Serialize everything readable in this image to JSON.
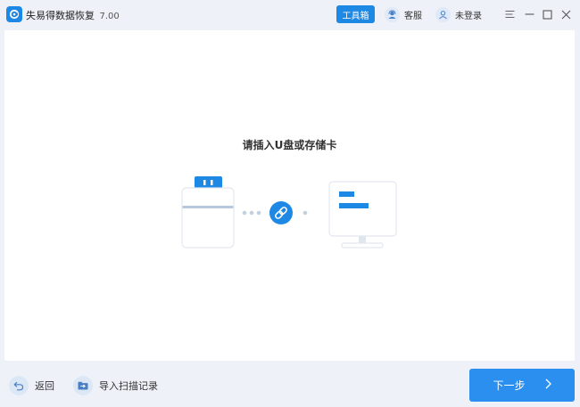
{
  "app": {
    "name": "失易得数据恢复",
    "version": "7.00"
  },
  "titlebar": {
    "toolbox_label": "工具箱",
    "service_label": "客服",
    "login_label": "未登录"
  },
  "main": {
    "prompt": "请插入U盘或存储卡"
  },
  "footer": {
    "back_label": "返回",
    "import_label": "导入扫描记录",
    "next_label": "下一步"
  },
  "colors": {
    "accent": "#1e88e5",
    "next_button": "#2b8ff0",
    "background": "#eef2f8"
  },
  "icons": {
    "logo": "app-logo-icon",
    "service": "headset-icon",
    "user": "user-icon",
    "menu": "menu-icon",
    "minimize": "minimize-icon",
    "maximize": "maximize-icon",
    "close": "close-icon",
    "link": "link-icon",
    "back": "back-arrow-icon",
    "import": "folder-import-icon",
    "next": "chevron-right-icon"
  }
}
